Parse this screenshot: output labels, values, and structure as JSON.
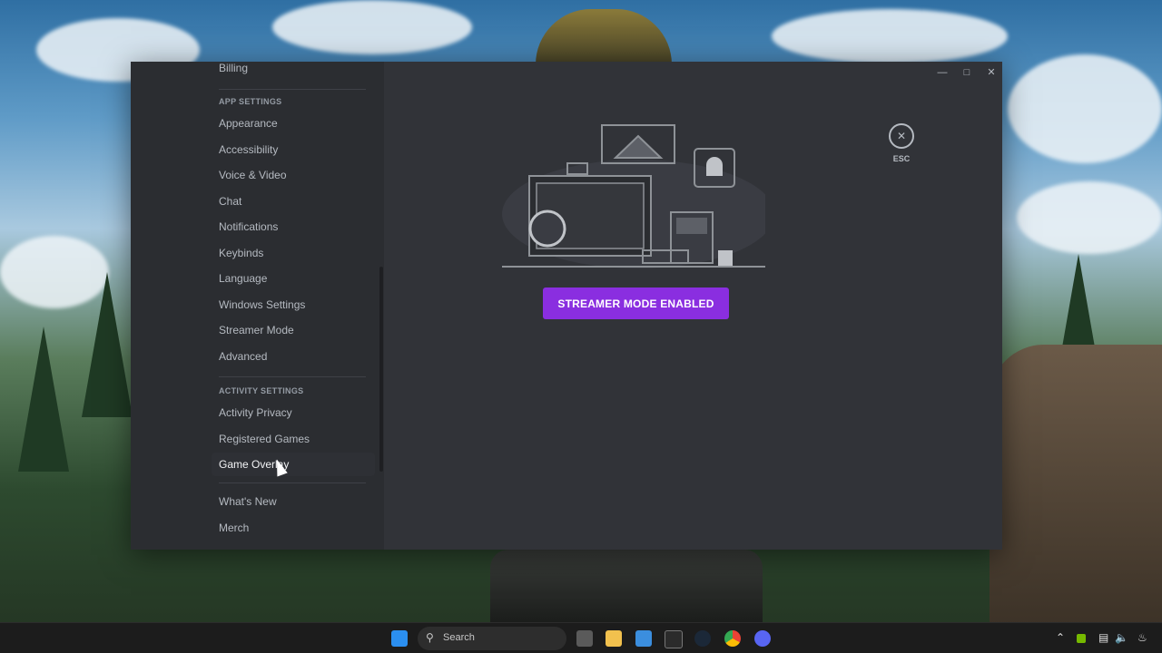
{
  "sidebar": {
    "top_item": "Billing",
    "app_settings_header": "APP SETTINGS",
    "app_items": [
      "Appearance",
      "Accessibility",
      "Voice & Video",
      "Chat",
      "Notifications",
      "Keybinds",
      "Language",
      "Windows Settings",
      "Streamer Mode",
      "Advanced"
    ],
    "activity_header": "ACTIVITY SETTINGS",
    "activity_items": [
      "Activity Privacy",
      "Registered Games",
      "Game Overlay"
    ],
    "other_items": [
      "What's New",
      "Merch"
    ],
    "active_item": "Game Overlay"
  },
  "main": {
    "streamer_button": "STREAMER MODE ENABLED",
    "esc_label": "ESC"
  },
  "taskbar": {
    "search_placeholder": "Search"
  },
  "colors": {
    "accent": "#8a2ee0",
    "sidebar_bg": "#2b2d31",
    "content_bg": "#313338"
  }
}
